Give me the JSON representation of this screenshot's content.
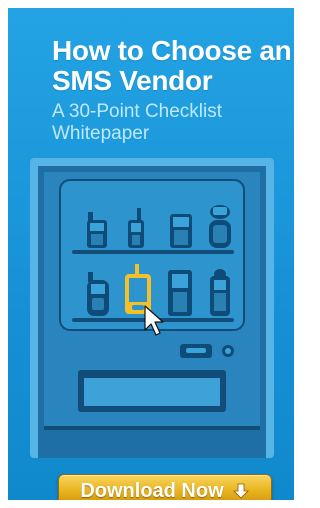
{
  "banner": {
    "title": "How to Choose an SMS Vendor",
    "subtitle": "A 30-Point Checklist Whitepaper",
    "button_label": "Download Now",
    "button_icon": "arrow-down-icon"
  },
  "machine": {
    "phones": [
      {
        "name": "phone-icon",
        "selected": false
      },
      {
        "name": "phone-icon",
        "selected": false
      },
      {
        "name": "phone-icon",
        "selected": false
      },
      {
        "name": "phone-icon",
        "selected": false
      },
      {
        "name": "phone-icon",
        "selected": false
      },
      {
        "name": "phone-icon",
        "selected": true
      },
      {
        "name": "phone-icon",
        "selected": false
      },
      {
        "name": "phone-icon",
        "selected": false
      }
    ],
    "cursor_icon": "mouse-cursor-icon"
  },
  "colors": {
    "background": "#1a96d8",
    "machine_body": "#1e6fa3",
    "machine_panel": "#2d94cd",
    "phone": "#0f4b78",
    "highlight": "#f2c02a",
    "button": "#e8b41e",
    "title": "#ffffff",
    "subtitle": "#bfe8ff"
  }
}
